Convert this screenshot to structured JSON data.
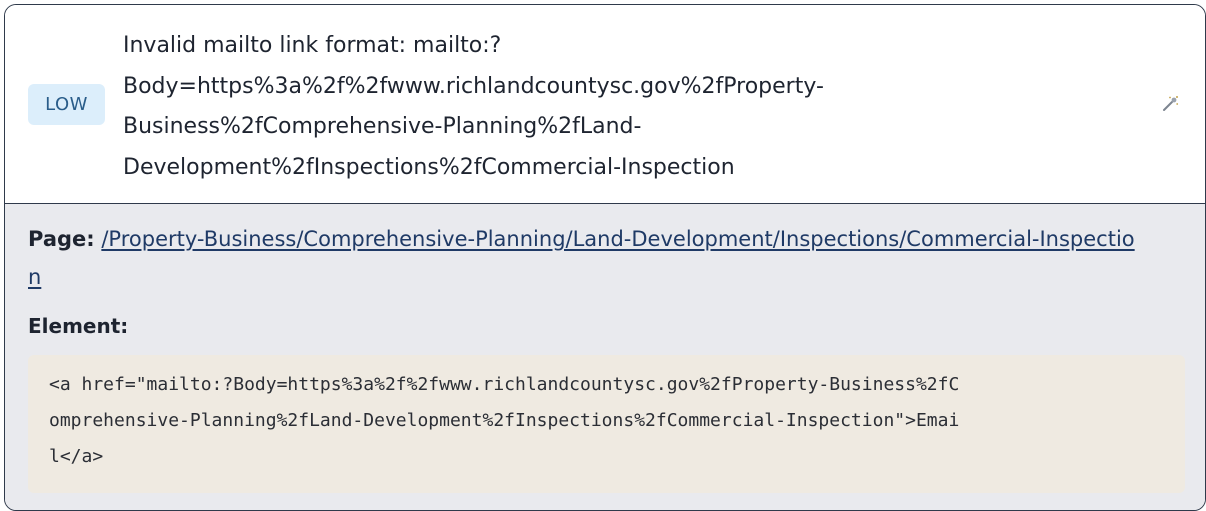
{
  "issue": {
    "severity": "LOW",
    "message_lines": [
      "Invalid mailto link format: mailto:?",
      "Body=https%3a%2f%2fwww.richlandcountysc.gov%2fProperty-",
      "Business%2fComprehensive-Planning%2fLand-",
      "Development%2fInspections%2fCommercial-Inspection"
    ],
    "action_icon": "magic-wand-icon"
  },
  "details": {
    "page_label": "Page:",
    "page_url_lines": [
      "/Property-Business/Comprehensive-Planning/Land-Development/Inspections/Commercial-Inspectio",
      "n"
    ],
    "element_label": "Element:",
    "element_code_lines": [
      "<a href=\"mailto:?Body=https%3a%2f%2fwww.richlandcountysc.gov%2fProperty-Business%2fC",
      "omprehensive-Planning%2fLand-Development%2fInspections%2fCommercial-Inspection\">Emai",
      "l</a>"
    ]
  },
  "colors": {
    "badge_bg": "#dceefb",
    "badge_text": "#2a5d8a",
    "details_bg": "#e9eaee",
    "code_bg": "#efeae1",
    "link": "#1f3a66"
  }
}
